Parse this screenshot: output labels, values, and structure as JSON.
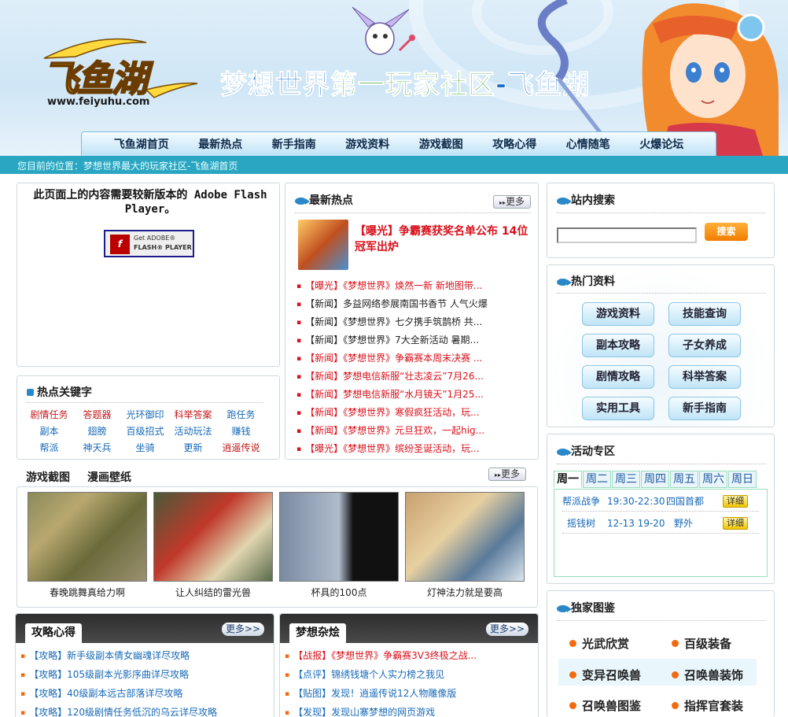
{
  "header": {
    "logo_text": "飞鱼湖",
    "logo_url": "www.feiyuhu.com",
    "slogan_part1": "梦想世界",
    "slogan_part2": "第一玩家社区",
    "slogan_part3": "-飞鱼湖"
  },
  "nav": {
    "items": [
      "飞鱼湖首页",
      "最新热点",
      "新手指南",
      "游戏资料",
      "游戏截图",
      "攻略心得",
      "心情随笔",
      "火爆论坛"
    ]
  },
  "breadcrumb": "您目前的位置：梦想世界最大的玩家社区-飞鱼湖首页",
  "flash": {
    "message": "此页面上的内容需要较新版本的 Adobe Flash Player。",
    "button_line1": "Get ADOBE®",
    "button_line2": "FLASH® PLAYER"
  },
  "keywords": {
    "title": "热点关键字",
    "items": [
      {
        "text": "剧情任务",
        "color": "red"
      },
      {
        "text": "答题器",
        "color": "red"
      },
      {
        "text": "光环御印",
        "color": "blue"
      },
      {
        "text": "科举答案",
        "color": "red"
      },
      {
        "text": "跑任务",
        "color": "blue"
      },
      {
        "text": "副本",
        "color": "blue"
      },
      {
        "text": "翅膀",
        "color": "blue"
      },
      {
        "text": "百级招式",
        "color": "blue"
      },
      {
        "text": "活动玩法",
        "color": "blue"
      },
      {
        "text": "赚钱",
        "color": "blue"
      },
      {
        "text": "帮派",
        "color": "blue"
      },
      {
        "text": "神天兵",
        "color": "blue"
      },
      {
        "text": "坐骑",
        "color": "blue"
      },
      {
        "text": "更新",
        "color": "blue"
      },
      {
        "text": "逍遥传说",
        "color": "red"
      }
    ]
  },
  "news": {
    "title": "最新热点",
    "more": "更多",
    "feature": "【曝光】争霸赛获奖名单公布 14位冠军出炉",
    "items": [
      {
        "text": "【曝光】《梦想世界》焕然一新 新地图带...",
        "color": "red"
      },
      {
        "text": "【新闻】多益网络参展南国书香节 人气火爆",
        "color": "dark"
      },
      {
        "text": "【新闻】《梦想世界》七夕携手筑鹊桥 共...",
        "color": "dark"
      },
      {
        "text": "【新闻】《梦想世界》7大全新活动 暑期...",
        "color": "dark"
      },
      {
        "text": "【新闻】《梦想世界》争霸赛本周末决赛 ...",
        "color": "red"
      },
      {
        "text": "【新闻】梦想电信新服“壮志凌云”7月26...",
        "color": "red"
      },
      {
        "text": "【新闻】梦想电信新服“水月镜天”1月25...",
        "color": "red"
      },
      {
        "text": "【新闻】《梦想世界》寒假疯狂活动，玩...",
        "color": "red"
      },
      {
        "text": "【新闻】《梦想世界》元旦狂欢，一起hig...",
        "color": "red"
      },
      {
        "text": "【曝光】《梦想世界》缤纷圣诞活动，玩...",
        "color": "red"
      }
    ]
  },
  "search": {
    "title": "站内搜索",
    "button": "搜索",
    "value": ""
  },
  "hot_data": {
    "title": "热门资料",
    "items": [
      "游戏资料",
      "技能查询",
      "副本攻略",
      "子女养成",
      "剧情攻略",
      "科举答案",
      "实用工具",
      "新手指南"
    ]
  },
  "activity": {
    "title": "活动专区",
    "tabs": [
      "周一",
      "周二",
      "周三",
      "周四",
      "周五",
      "周六",
      "周日"
    ],
    "active_tab": "周一",
    "rows": [
      {
        "name": "帮派战争",
        "time": "19:30-22:30",
        "place": "四国首都",
        "button": "详细"
      },
      {
        "name": "摇钱树",
        "time": "12-13 19-20",
        "place": "野外",
        "button": "详细"
      }
    ]
  },
  "exclusive": {
    "title": "独家图鉴",
    "items": [
      "光武欣赏",
      "百级装备",
      "变异召唤兽",
      "召唤兽装饰",
      "召唤兽图鉴",
      "指挥官套装"
    ]
  },
  "screenshots": {
    "tabs": [
      "游戏截图",
      "漫画壁纸"
    ],
    "more": "更多",
    "items": [
      {
        "caption": "春晚跳舞真给力啊"
      },
      {
        "caption": "让人纠结的雷光兽"
      },
      {
        "caption": "杯具的100点"
      },
      {
        "caption": "灯神法力就是要高"
      }
    ]
  },
  "strategy": {
    "title": "攻略心得",
    "more": "更多>>",
    "items": [
      "【攻略】新手级副本倩女幽魂详尽攻略",
      "【攻略】105级副本光影序曲详尽攻略",
      "【攻略】40级副本远古部落详尽攻略",
      "【攻略】120级剧情任务低沉的乌云详尽攻略"
    ]
  },
  "misc": {
    "title": "梦想杂烩",
    "more": "更多>>",
    "items": [
      {
        "text": "【战报】《梦想世界》争霸赛3V3终极之战...",
        "color": "red"
      },
      {
        "text": "【点评】锦绣钱塘个人实力榜之我见",
        "color": "blue"
      },
      {
        "text": "【贴图】发现！逍遥传说12人物雕像版",
        "color": "blue"
      },
      {
        "text": "【发现】发现山寨梦想的网页游戏",
        "color": "blue"
      }
    ]
  }
}
